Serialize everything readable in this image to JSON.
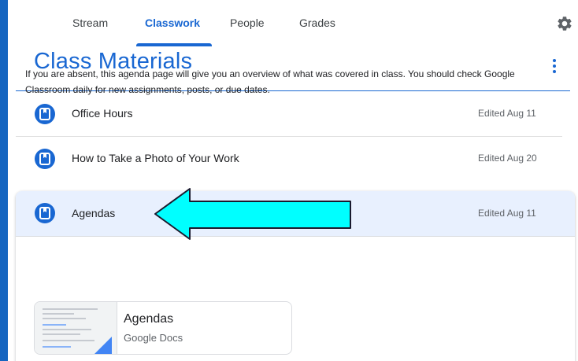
{
  "tabs": [
    {
      "label": "Stream",
      "active": false
    },
    {
      "label": "Classwork",
      "active": true
    },
    {
      "label": "People",
      "active": false
    },
    {
      "label": "Grades",
      "active": false
    }
  ],
  "header": {
    "title": "Class Materials"
  },
  "materials": [
    {
      "title": "Office Hours",
      "edited": "Edited Aug 11",
      "icon": "material-book-icon"
    },
    {
      "title": "How to Take a Photo of Your Work",
      "edited": "Edited Aug 20",
      "icon": "material-book-icon"
    },
    {
      "title": "Agendas",
      "edited": "Edited Aug 11",
      "icon": "material-book-icon",
      "expanded": true
    }
  ],
  "expanded": {
    "description": "If you are absent, this agenda page will give you an overview of what was covered in class. You should check Google Classroom daily for new assignments, posts, or due dates.",
    "attachment": {
      "title": "Agendas",
      "type": "Google Docs"
    }
  },
  "colors": {
    "accent": "#1967d2",
    "selected_row": "#e8f0fe",
    "annotation_arrow": "#00ffff",
    "desktop": "#1565c0"
  },
  "icons": {
    "settings": "gear-icon",
    "more": "more-vert-icon",
    "annotation": "left-arrow-annotation"
  }
}
